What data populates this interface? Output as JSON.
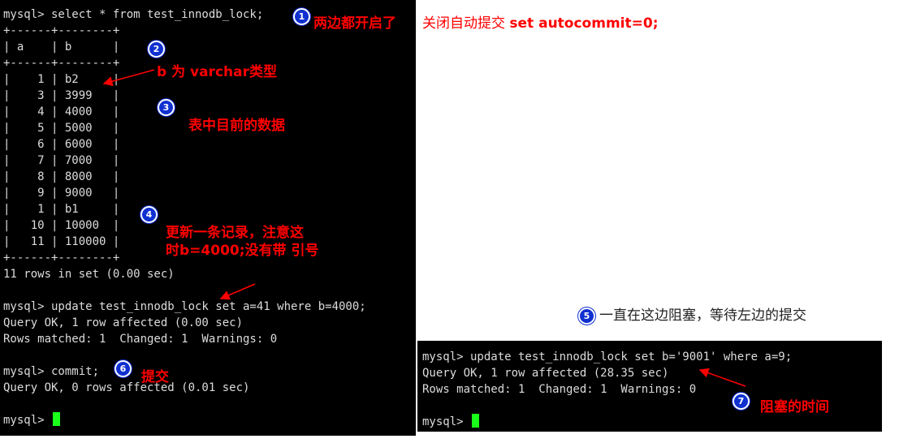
{
  "left_terminal": {
    "lines": [
      "mysql> select * from test_innodb_lock;",
      "+------+--------+",
      "| a    | b      |",
      "+------+--------+",
      "|    1 | b2     |",
      "|    3 | 3999   |",
      "|    4 | 4000   |",
      "|    5 | 5000   |",
      "|    6 | 6000   |",
      "|    7 | 7000   |",
      "|    8 | 8000   |",
      "|    9 | 9000   |",
      "|    1 | b1     |",
      "|   10 | 10000  |",
      "|   11 | 110000 |",
      "+------+--------+",
      "11 rows in set (0.00 sec)",
      "",
      "mysql> update test_innodb_lock set a=41 where b=4000;",
      "Query OK, 1 row affected (0.00 sec)",
      "Rows matched: 1  Changed: 1  Warnings: 0",
      "",
      "mysql> commit;",
      "Query OK, 0 rows affected (0.01 sec)",
      ""
    ],
    "prompt": "mysql> "
  },
  "right_terminal": {
    "lines": [
      "mysql> update test_innodb_lock set b='9001' where a=9;",
      "Query OK, 1 row affected (28.35 sec)",
      "Rows matched: 1  Changed: 1  Warnings: 0",
      ""
    ],
    "prompt": "mysql> "
  },
  "annotations": {
    "a1_part1": "两边都开启了",
    "a1_part2": "关闭自动提交 ",
    "a1_part3": "set autocommit=0;",
    "a2": "b 为 varchar类型",
    "a3": "表中目前的数据",
    "a4_line1": "更新一条记录，注意这",
    "a4_line2": "时b=4000;没有带 引号",
    "a5": "一直在这边阻塞，等待左边的提交",
    "a6": "提交",
    "a7": "阻塞的时间"
  },
  "badges": [
    "1",
    "2",
    "3",
    "4",
    "5",
    "6",
    "7"
  ],
  "colors": {
    "terminal_bg": "#000000",
    "terminal_text": "#dcdcdc",
    "cursor": "#1aff1a",
    "annotation": "#ff0000",
    "badge": "#1030d0"
  }
}
